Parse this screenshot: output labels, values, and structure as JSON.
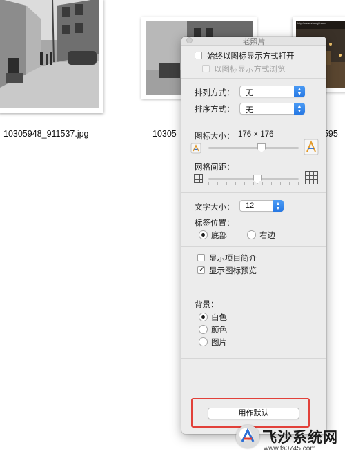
{
  "finder": {
    "files": [
      {
        "name": "10305948_911537.jpg"
      },
      {
        "name": "10305"
      },
      {
        "name": "7595"
      }
    ],
    "thumb3_caption": "http://www.zhong5.com"
  },
  "panel": {
    "title": "老照片",
    "always_open_icon_view": {
      "label": "始终以图标显示方式打开",
      "checked": false
    },
    "browse_icon_view": {
      "label": "以图标显示方式浏览",
      "checked": false,
      "enabled": false
    },
    "arrange_by": {
      "label": "排列方式：",
      "value": "无"
    },
    "sort_by": {
      "label": "排序方式：",
      "value": "无"
    },
    "icon_size": {
      "label": "图标大小：",
      "value": "176 × 176",
      "level": 0.6
    },
    "grid_spacing": {
      "label": "网格间距：",
      "level": 0.5
    },
    "text_size": {
      "label": "文字大小：",
      "value": "12"
    },
    "label_position": {
      "label": "标签位置：",
      "options": [
        {
          "label": "底部",
          "selected": true
        },
        {
          "label": "右边",
          "selected": false
        }
      ]
    },
    "show_item_info": {
      "label": "显示项目简介",
      "checked": false
    },
    "show_icon_preview": {
      "label": "显示图标预览",
      "checked": true
    },
    "background": {
      "label": "背景：",
      "options": [
        {
          "label": "白色",
          "selected": true
        },
        {
          "label": "颜色",
          "selected": false
        },
        {
          "label": "图片",
          "selected": false
        }
      ]
    },
    "use_as_defaults": "用作默认"
  },
  "watermark": {
    "brand": "飞沙系统网",
    "url": "www.fs0745.com"
  },
  "colors": {
    "highlight": "#e2413a",
    "popup_accent": "#2f80ec"
  }
}
